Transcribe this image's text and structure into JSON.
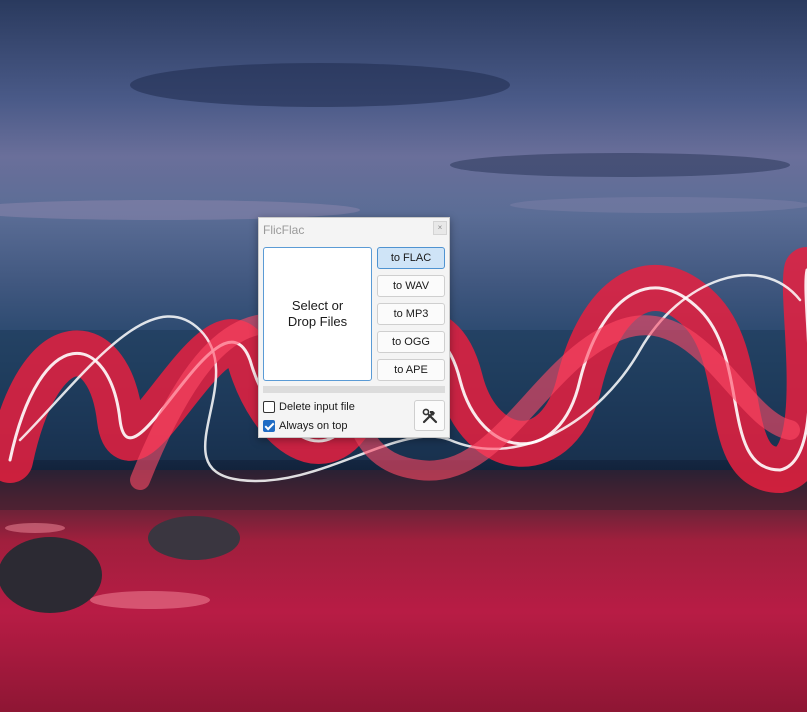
{
  "window": {
    "title": "FlicFlac",
    "close_glyph": "×"
  },
  "drop_zone": {
    "line1": "Select or",
    "line2": "Drop Files"
  },
  "buttons": {
    "flac": "to FLAC",
    "wav": "to WAV",
    "mp3": "to MP3",
    "ogg": "to OGG",
    "ape": "to APE"
  },
  "options": {
    "delete_input": {
      "label": "Delete input file",
      "checked": false
    },
    "always_on_top": {
      "label": "Always on top",
      "checked": true
    }
  },
  "progress": {
    "value": 0
  },
  "settings": {
    "icon": "tools-icon"
  },
  "colors": {
    "accent": "#1f6cc4",
    "active_button": "#cfe4f7",
    "drop_border": "#5b9bd5"
  }
}
